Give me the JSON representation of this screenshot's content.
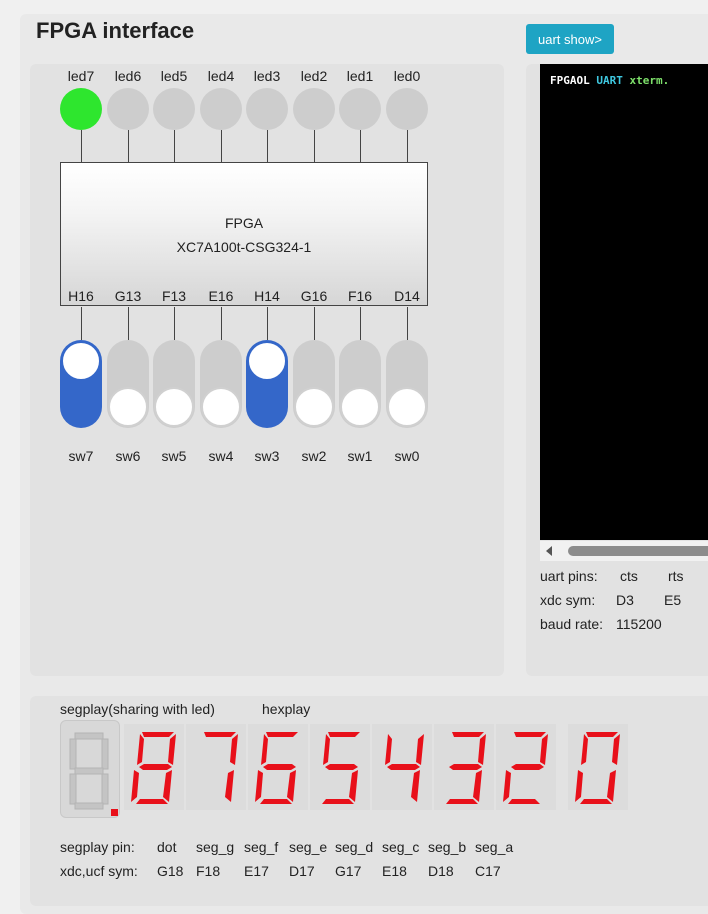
{
  "title": "FPGA interface",
  "uart_button": "uart show>",
  "leds": [
    {
      "label": "led7",
      "pin": "G18",
      "on": true
    },
    {
      "label": "led6",
      "pin": "F18",
      "on": false
    },
    {
      "label": "led5",
      "pin": "E17",
      "on": false
    },
    {
      "label": "led4",
      "pin": "D17",
      "on": false
    },
    {
      "label": "led3",
      "pin": "G17",
      "on": false
    },
    {
      "label": "led2",
      "pin": "E18",
      "on": false
    },
    {
      "label": "led1",
      "pin": "D18",
      "on": false
    },
    {
      "label": "led0",
      "pin": "C17",
      "on": false
    }
  ],
  "fpga": {
    "name": "FPGA",
    "part": "XC7A100t-CSG324-1"
  },
  "switches": [
    {
      "label": "sw7",
      "pin": "H16",
      "on": true
    },
    {
      "label": "sw6",
      "pin": "G13",
      "on": false
    },
    {
      "label": "sw5",
      "pin": "F13",
      "on": false
    },
    {
      "label": "sw4",
      "pin": "E16",
      "on": false
    },
    {
      "label": "sw3",
      "pin": "H14",
      "on": true
    },
    {
      "label": "sw2",
      "pin": "G16",
      "on": false
    },
    {
      "label": "sw1",
      "pin": "F16",
      "on": false
    },
    {
      "label": "sw0",
      "pin": "D14",
      "on": false
    }
  ],
  "terminal": {
    "word1": "FPGAOL",
    "word2": "UART",
    "word3": "xterm.",
    "color1": "#ffffff",
    "color2": "#3fc8e0",
    "color3": "#7de06a"
  },
  "uart_info": {
    "pins_label": "uart pins:",
    "pin1": "cts",
    "pin2": "rts",
    "xdc_label": "xdc sym:",
    "xdc1": "D3",
    "xdc2": "E5",
    "baud_label": "baud rate:",
    "baud_value": "115200"
  },
  "segplay": {
    "label": "segplay(sharing with led)",
    "hexplay_label": "hexplay",
    "digits": [
      "8",
      "7",
      "6",
      "5",
      "4",
      "3",
      "2",
      "0"
    ],
    "segment_color": "#e8101a",
    "table": {
      "row1": [
        "segplay pin:",
        "dot",
        "seg_g",
        "seg_f",
        "seg_e",
        "seg_d",
        "seg_c",
        "seg_b",
        "seg_a"
      ],
      "row2": [
        "xdc,ucf sym:",
        "G18",
        "F18",
        "E17",
        "D17",
        "G17",
        "E18",
        "D18",
        "C17"
      ]
    }
  }
}
